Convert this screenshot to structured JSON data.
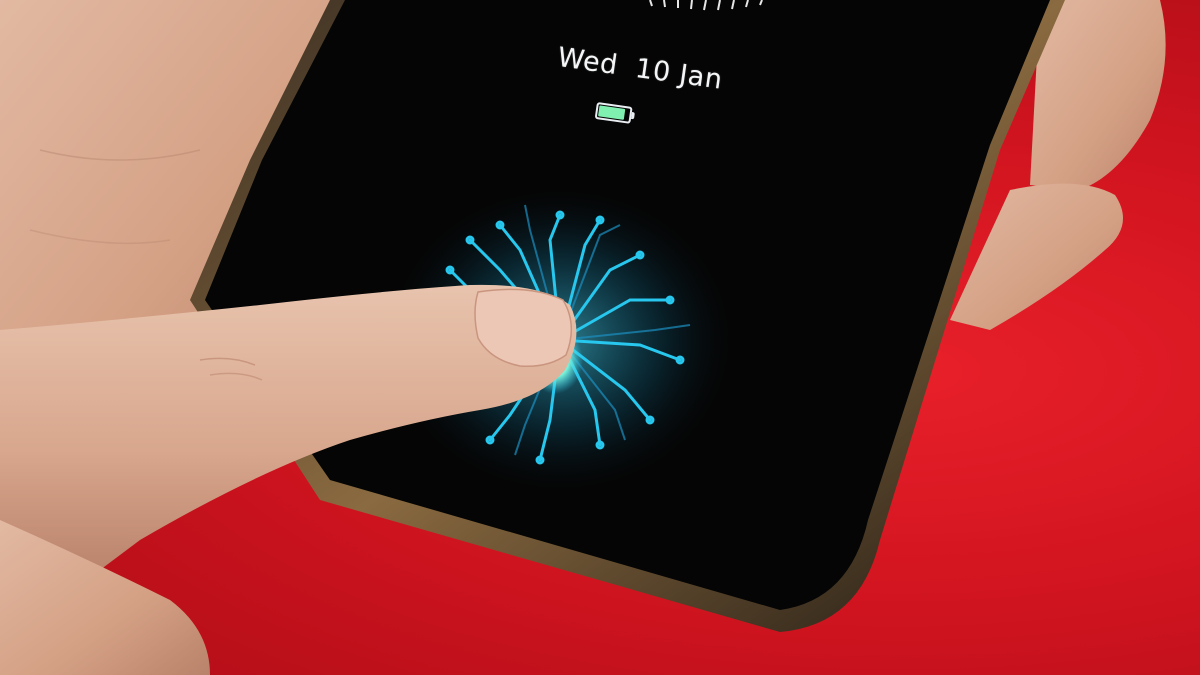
{
  "lock_screen": {
    "date_text": "Wed  10 Jan",
    "battery_level": 0.88,
    "battery_fill_color": "#7ff0b0",
    "fingerprint_glow_color": "#27c7ee",
    "fingerprint_core_color": "#9cf5e0"
  },
  "scene": {
    "background_color": "#d0141f",
    "phone_frame_color": "#2a2118",
    "phone_screen_color": "#050505",
    "skin_color": "#d9ab92",
    "icons": [
      "fingerprint-icon",
      "battery-icon"
    ]
  }
}
